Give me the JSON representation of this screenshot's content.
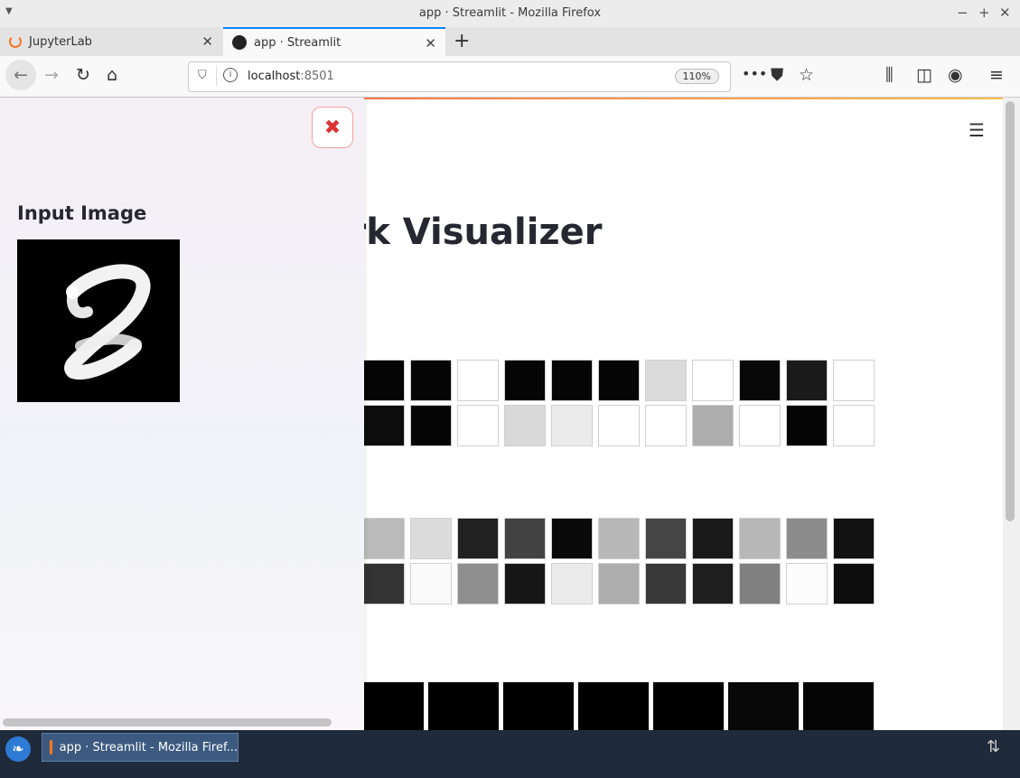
{
  "window": {
    "title": "app · Streamlit - Mozilla Firefox",
    "menu_icon": "chevron-down-icon",
    "controls": [
      "minimize-icon",
      "maximize-icon",
      "close-icon"
    ]
  },
  "tabs": [
    {
      "label": "JupyterLab",
      "icon": "jupyter-icon",
      "active": false
    },
    {
      "label": "app · Streamlit",
      "icon": "streamlit-icon",
      "active": true
    }
  ],
  "navbar": {
    "url_host": "localhost",
    "url_port": ":8501",
    "zoom": "110%"
  },
  "page": {
    "heading_visible": "ork Visualizer",
    "accent_gradient": [
      "#ff4b4b",
      "#ffbd45"
    ],
    "grid1": [
      [
        0.02,
        0.02,
        1.0,
        0.02,
        0.02,
        0.02,
        0.86,
        1.0,
        0.03,
        0.1,
        1.0
      ],
      [
        0.05,
        0.02,
        1.0,
        0.85,
        0.92,
        1.0,
        1.0,
        0.68,
        1.0,
        0.02,
        1.0
      ]
    ],
    "grid2": [
      [
        0.73,
        0.86,
        0.13,
        0.26,
        0.04,
        0.72,
        0.27,
        0.1,
        0.72,
        0.55,
        0.07
      ],
      [
        0.2,
        0.98,
        0.56,
        0.09,
        0.92,
        0.68,
        0.22,
        0.12,
        0.5,
        0.99,
        0.05
      ]
    ],
    "grid3": [
      0.0,
      0.0,
      0.0,
      0.0,
      0.0,
      0.03,
      0.02
    ]
  },
  "sidebar": {
    "title": "Input Image",
    "close_icon": "close-icon"
  },
  "taskbar": {
    "task_label": "app · Streamlit - Mozilla Firef...",
    "start_icon": "start-menu-icon",
    "tray_icon": "network-icon"
  }
}
